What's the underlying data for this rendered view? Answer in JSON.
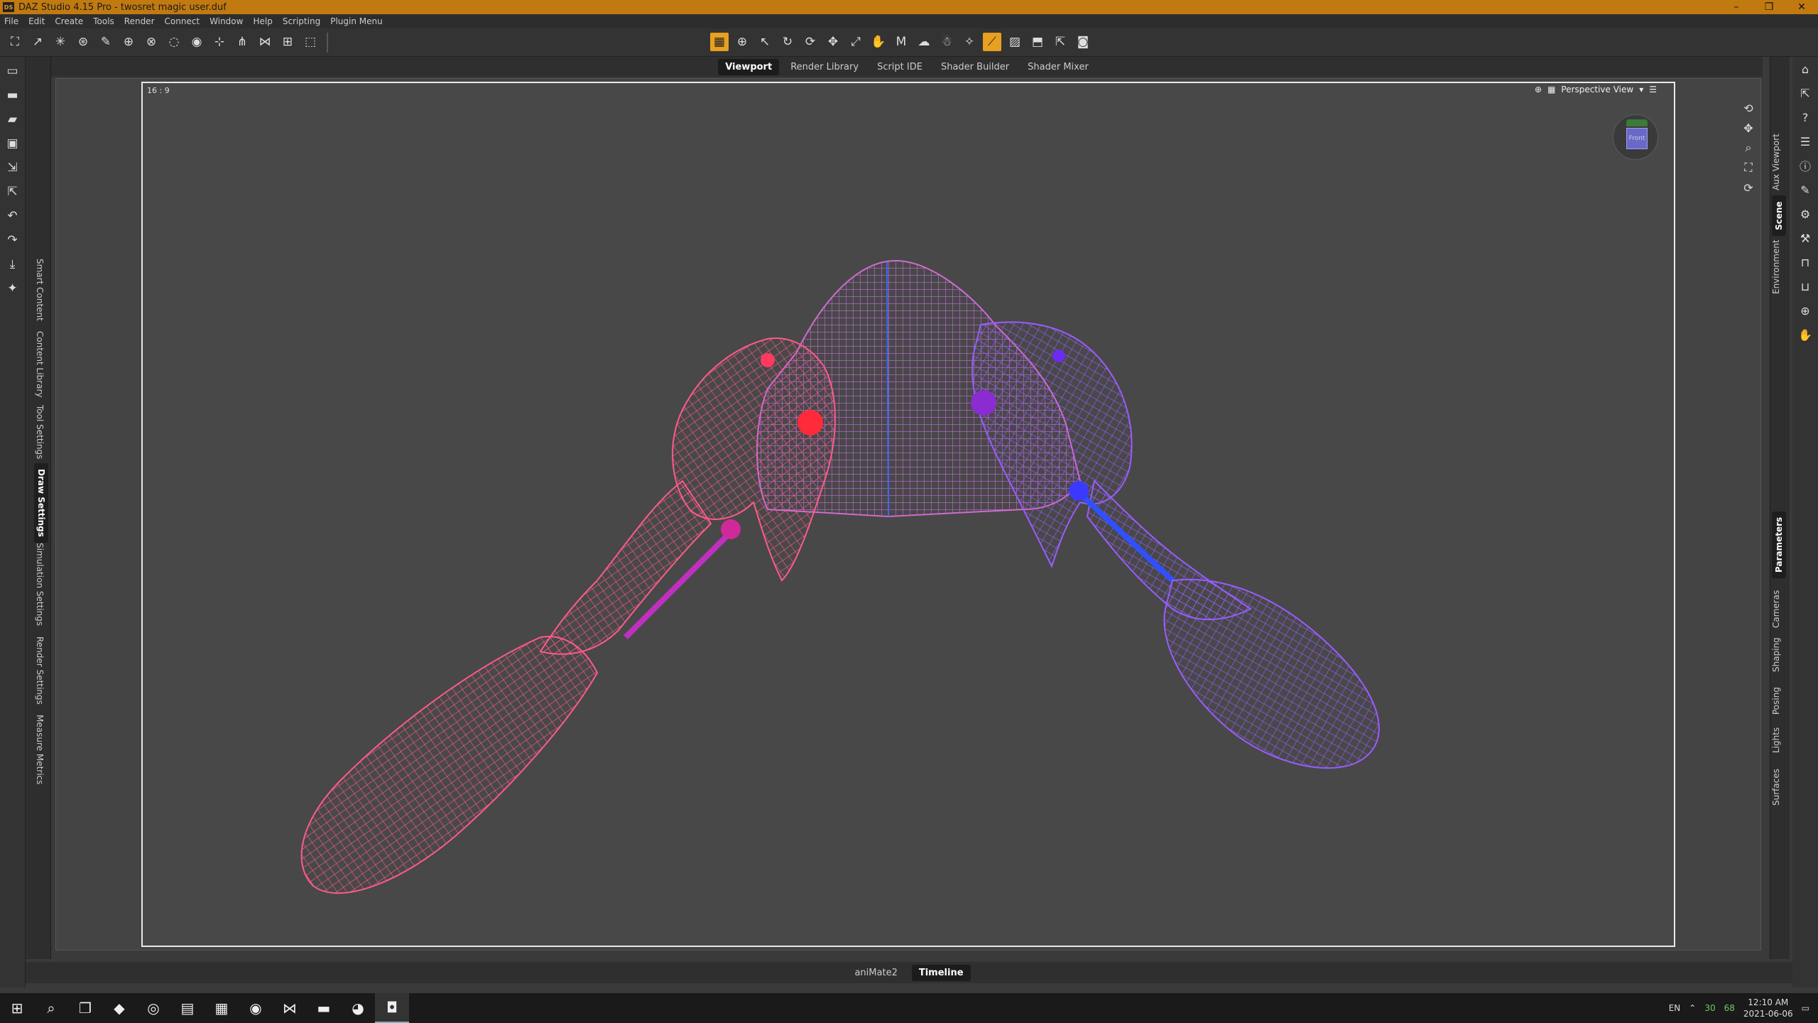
{
  "window": {
    "title": "DAZ Studio 4.15 Pro - twosret magic user.duf",
    "app_icon_text": "DS",
    "minimize": "–",
    "maximize": "❐",
    "close": "✕"
  },
  "menu": [
    "File",
    "Edit",
    "Create",
    "Tools",
    "Render",
    "Connect",
    "Window",
    "Help",
    "Scripting",
    "Plugin Menu"
  ],
  "main_tabs": {
    "viewport": "Viewport",
    "render_library": "Render Library",
    "script_ide": "Script IDE",
    "shader_builder": "Shader Builder",
    "shader_mixer": "Shader Mixer"
  },
  "left_tabs": {
    "smart_content": "Smart Content",
    "content_library": "Content Library",
    "tool_settings": "Tool Settings",
    "draw_settings": "Draw Settings",
    "simulation_settings": "Simulation Settings",
    "render_settings": "Render Settings",
    "measure_metrics": "Measure Metrics"
  },
  "right_tabs": {
    "aux_viewport": "Aux Viewport",
    "scene": "Scene",
    "environment": "Environment",
    "parameters": "Parameters",
    "cameras": "Cameras",
    "shaping": "Shaping",
    "posing": "Posing",
    "lights": "Lights",
    "surfaces": "Surfaces"
  },
  "viewport": {
    "aspect_label": "16 : 9",
    "view_name": "Perspective View",
    "navcube_face": "Front",
    "colors": {
      "left_mesh": "#ff5a8a",
      "right_mesh": "#9a5cff",
      "seam": "#4466ff"
    }
  },
  "bottom_tabs": {
    "animate2": "aniMate2",
    "timeline": "Timeline"
  },
  "taskbar": {
    "language": "EN",
    "tray_temp": "30",
    "tray_val": "68",
    "time": "12:10 AM",
    "date": "2021-06-06"
  }
}
